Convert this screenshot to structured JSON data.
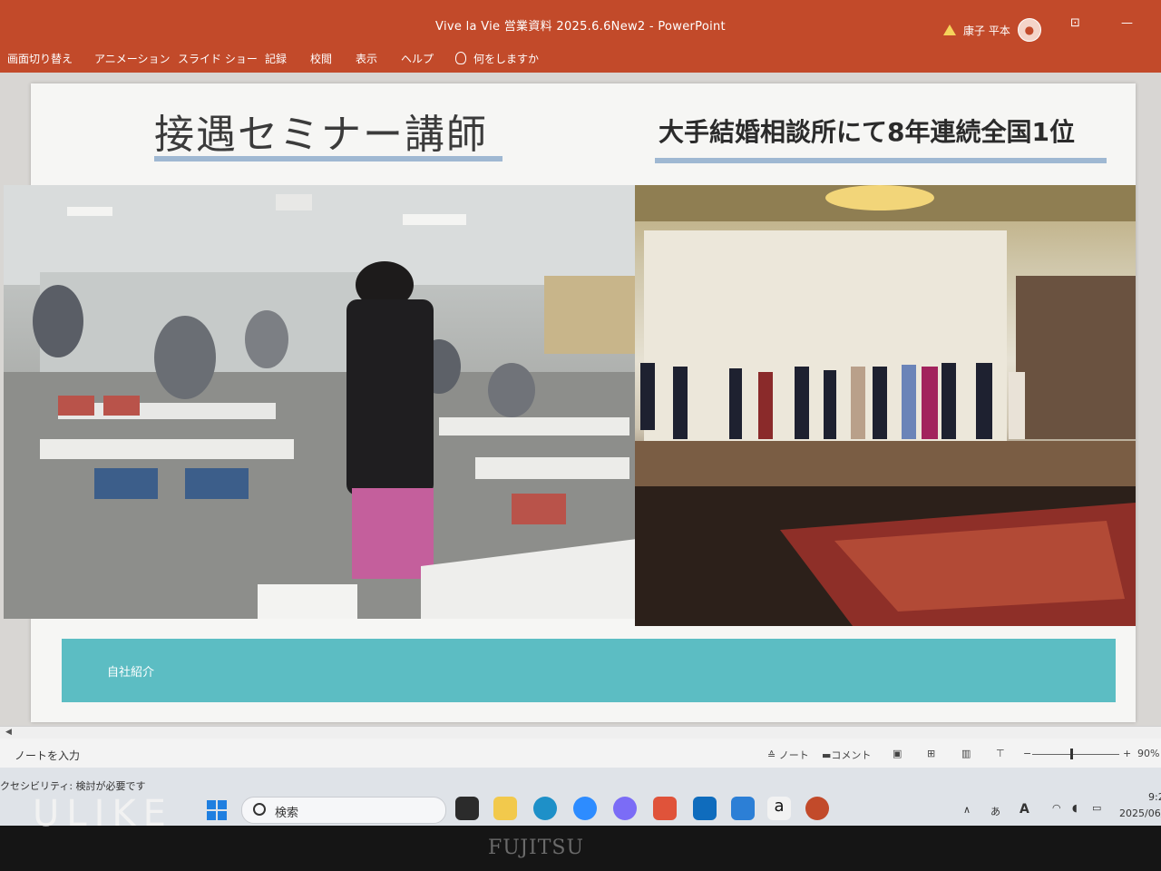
{
  "window": {
    "title": "Vive la Vie  営業資料 2025.6.6New2  -  PowerPoint",
    "user_name": "康子 平本"
  },
  "ribbon": {
    "tabs": [
      "画面切り替え",
      "アニメーション",
      "スライド ショー",
      "記録",
      "校閲",
      "表示",
      "ヘルプ"
    ],
    "tell_me": "何をしますか"
  },
  "slide": {
    "title": "接遇セミナー講師",
    "subtitle": "大手結婚相談所にて8年連続全国1位",
    "footer_label": "自社紹介"
  },
  "notes": {
    "placeholder": "ノートを入力",
    "notes_button": "ノート",
    "comments_button": "コメント",
    "zoom": "90%"
  },
  "status": {
    "accessibility": "クセシビリティ: 検討が必要です",
    "time": "9:2",
    "date": "2025/06/0"
  },
  "taskbar": {
    "search_placeholder": "検索",
    "ime": "あ"
  },
  "device": {
    "brand": "FUJITSU",
    "watermark": "ULIKE"
  },
  "colors": {
    "accent": "#c24a2a",
    "footer_bar": "#5cbdc3",
    "title_underline": "#9fb8d2"
  }
}
